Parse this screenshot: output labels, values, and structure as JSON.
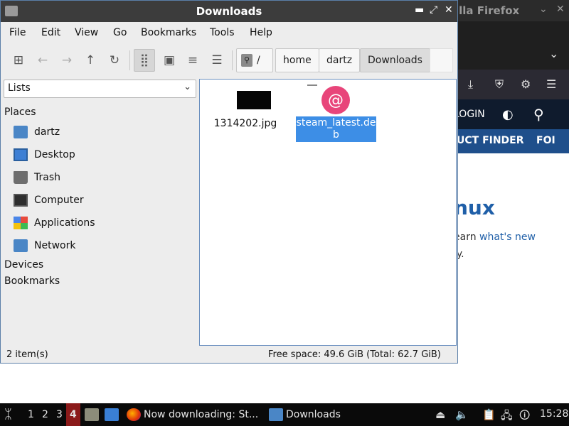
{
  "firefox": {
    "title": "illa Firefox",
    "site_bar": {
      "login": "LOGIN"
    },
    "nav": {
      "item1": "UCT FINDER",
      "item2": "FOI"
    },
    "content": {
      "heading": "nux",
      "line1_prefix": "earn ",
      "line1_link": "what's new",
      "line2": "ly."
    }
  },
  "thunar": {
    "title": "Downloads",
    "menu": [
      "File",
      "Edit",
      "View",
      "Go",
      "Bookmarks",
      "Tools",
      "Help"
    ],
    "path": [
      "/",
      "home",
      "dartz",
      "Downloads"
    ],
    "sidebar": {
      "select": "Lists",
      "places_header": "Places",
      "places": [
        "dartz",
        "Desktop",
        "Trash",
        "Computer",
        "Applications",
        "Network"
      ],
      "devices_header": "Devices",
      "bookmarks_header": "Bookmarks"
    },
    "files": [
      {
        "name": "1314202.jpg"
      },
      {
        "name_line1": "steam_latest.de",
        "name_line2": "b"
      }
    ],
    "status": {
      "count": "2 item(s)",
      "free": "Free space: 49.6 GiB (Total: 62.7 GiB)"
    }
  },
  "taskbar": {
    "workspaces": [
      "1",
      "2",
      "3",
      "4"
    ],
    "tasks": [
      "Now downloading: St...",
      "Downloads"
    ],
    "clock": "15:28"
  }
}
